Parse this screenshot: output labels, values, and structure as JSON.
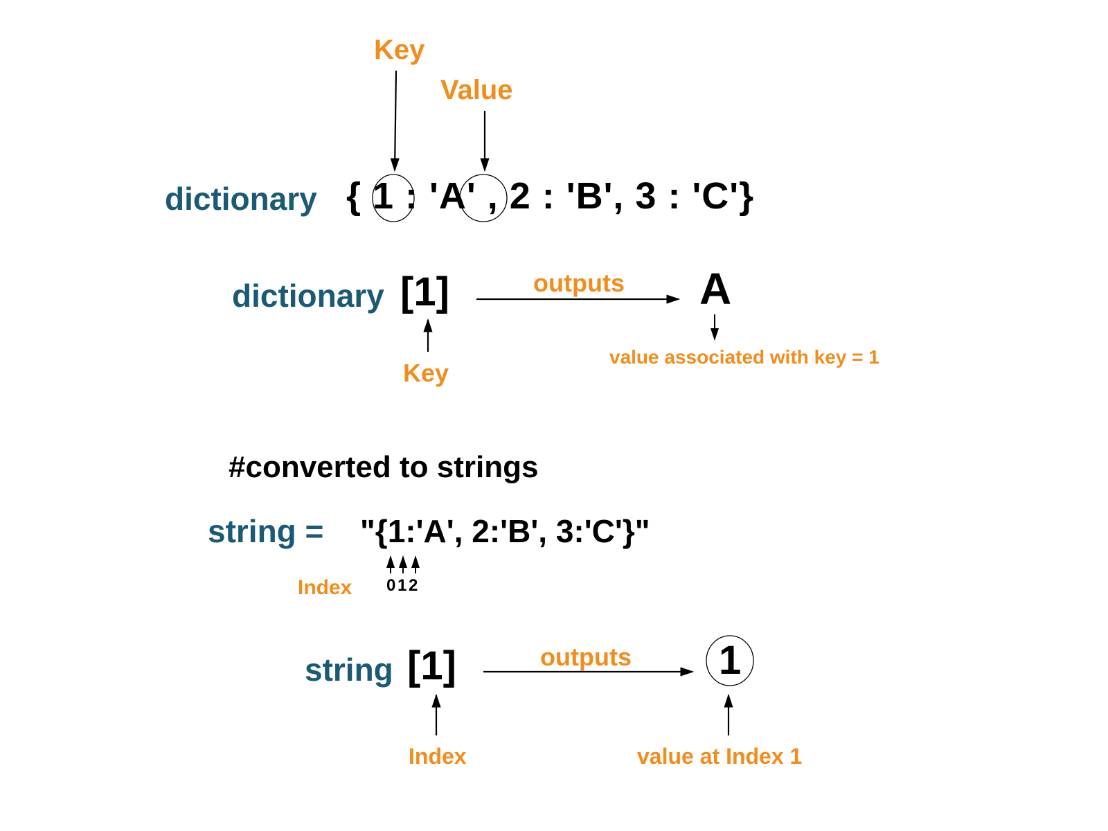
{
  "labels": {
    "key": "Key",
    "value": "Value",
    "dictionary": "dictionary",
    "outputs": "outputs",
    "key2": "Key",
    "value_assoc": "value associated with key = 1",
    "comment": "#converted to strings",
    "string_eq": "string =",
    "index": "Index",
    "index2": "Index",
    "value_at_index": "value at Index  1",
    "string": "string",
    "idx_chars": "0 1 2"
  },
  "code": {
    "dict_literal": "{  1  : 'A' , 2 : 'B', 3 : 'C'}",
    "access_open": "[1]",
    "result_A": "A",
    "string_literal": "\"{1:'A', 2:'B', 3:'C'}\"",
    "result_1": "1"
  }
}
